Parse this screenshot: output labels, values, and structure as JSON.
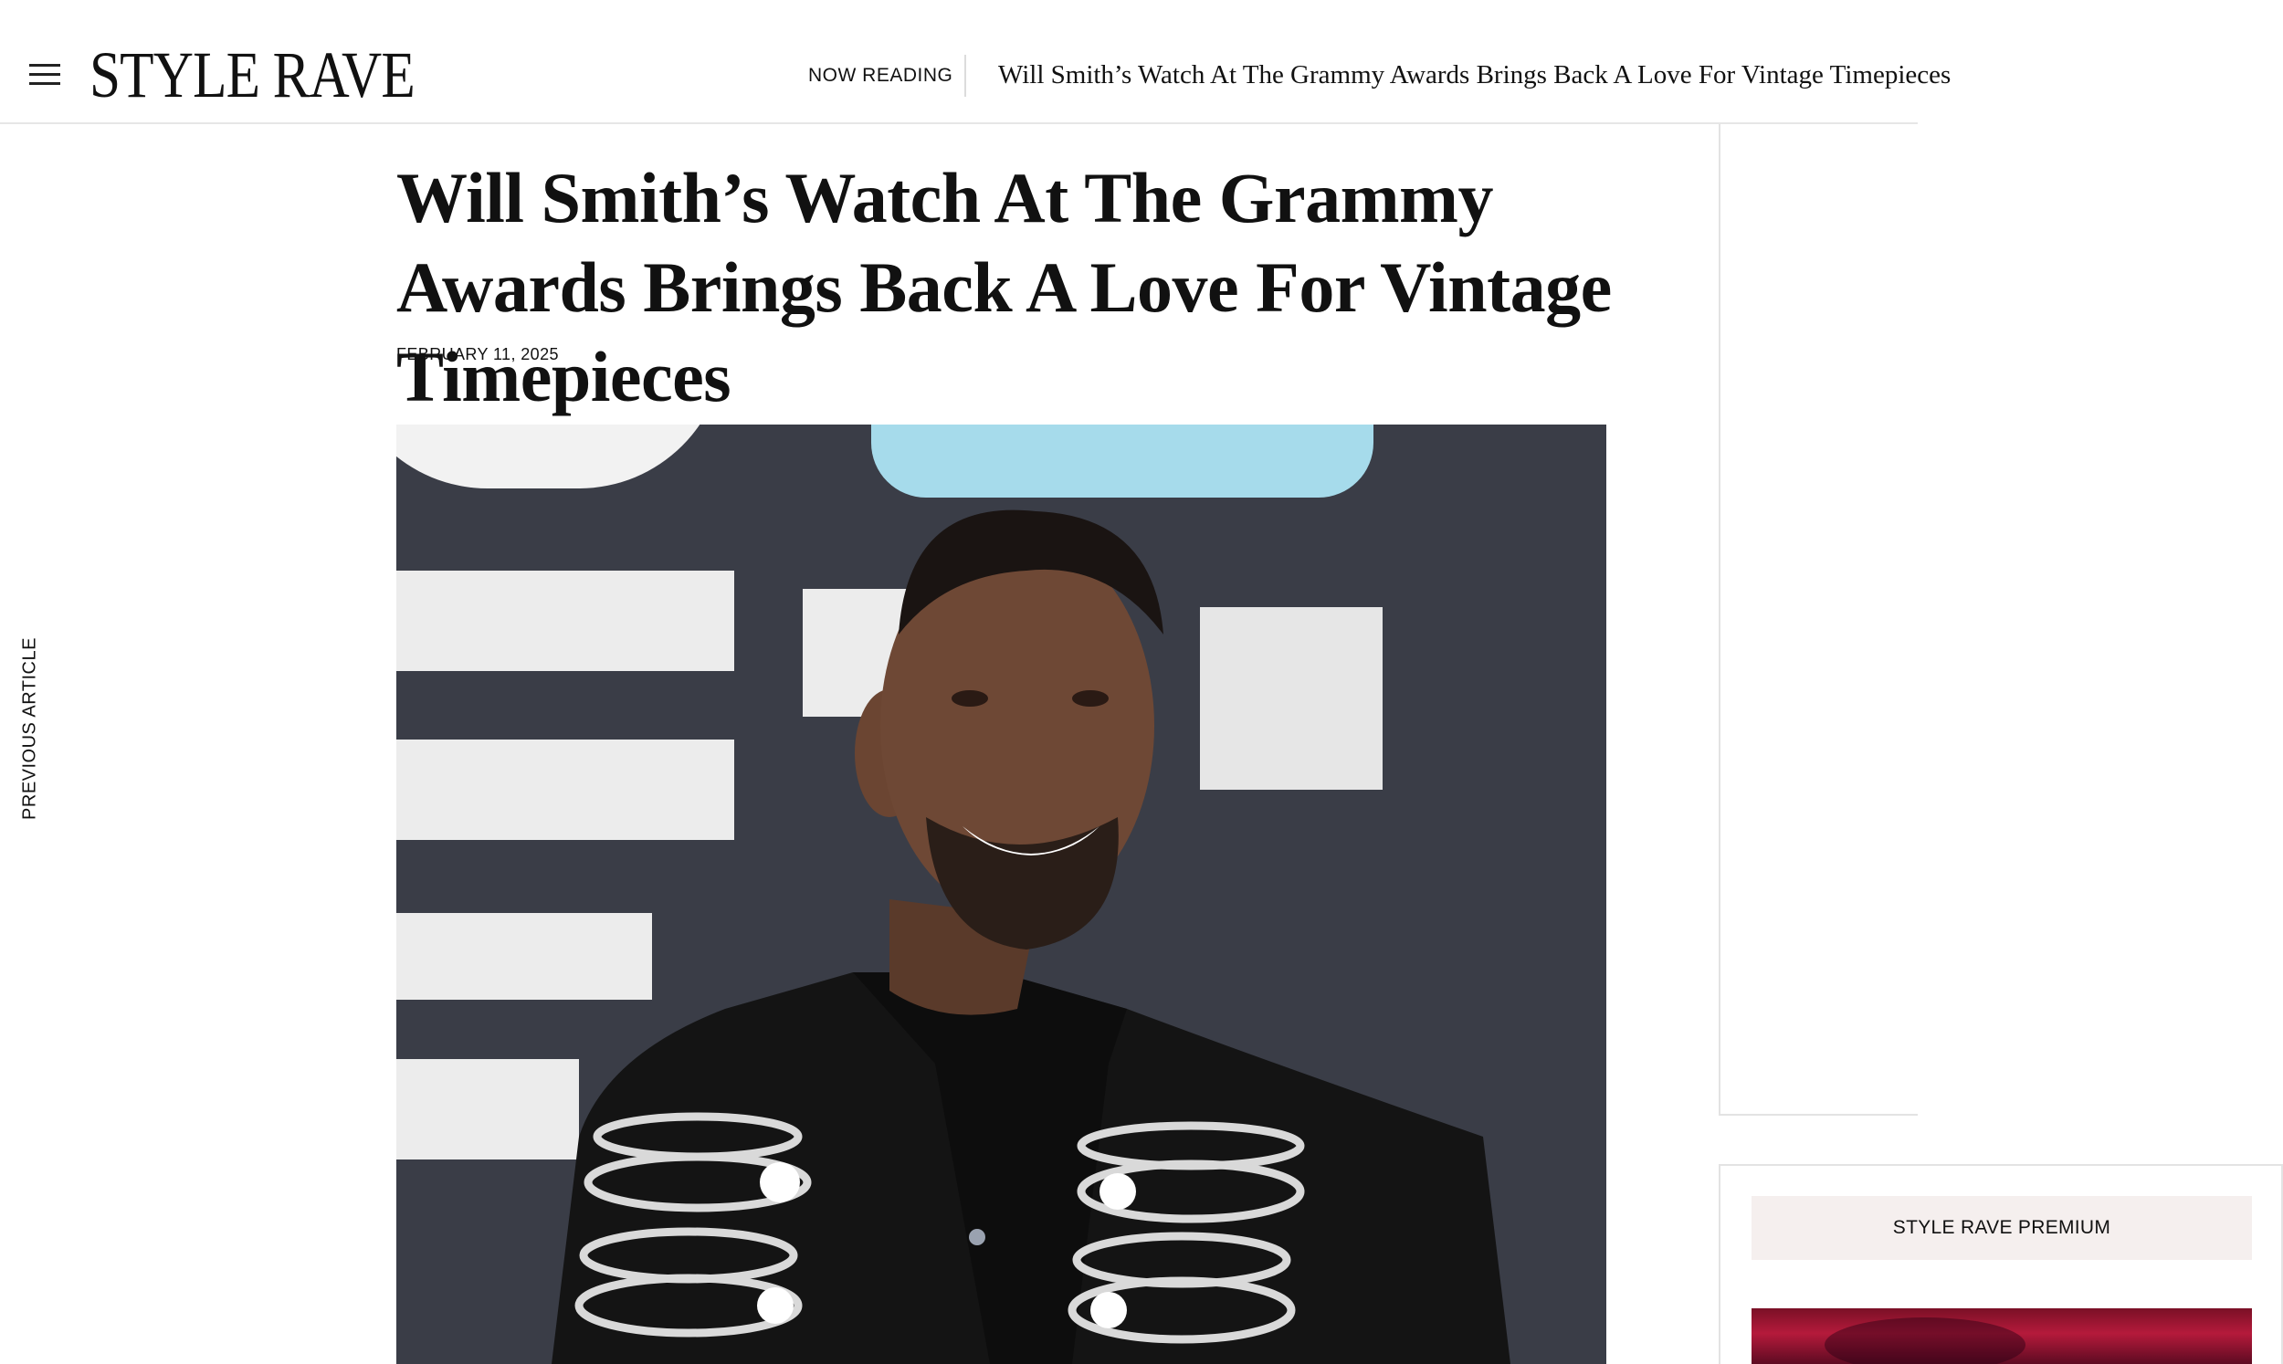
{
  "header": {
    "logo": "STYLE RAVE",
    "now_reading_label": "NOW READING",
    "now_reading_title": "Will Smith’s Watch At The Grammy Awards Brings Back A Love For Vintage Timepieces"
  },
  "nav": {
    "previous_article": "PREVIOUS ARTICLE"
  },
  "article": {
    "title": "Will Smith’s Watch At The Grammy Awards Brings Back A Love For Vintage Timepieces",
    "date": "FEBRUARY 11, 2025"
  },
  "sidebar": {
    "premium_label": "STYLE RAVE PREMIUM"
  },
  "icons": {
    "menu": "hamburger-menu-icon"
  }
}
